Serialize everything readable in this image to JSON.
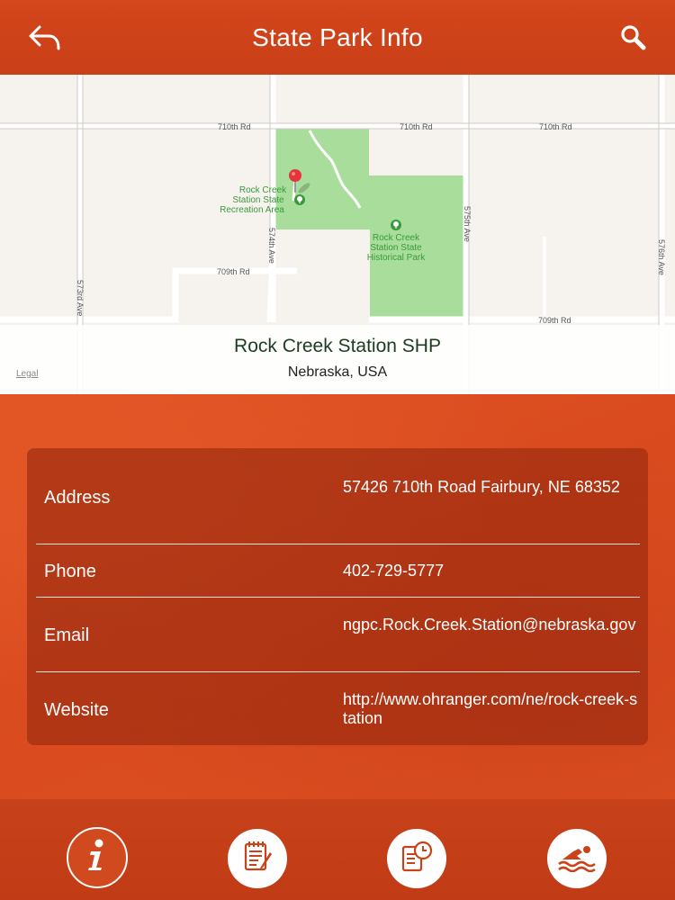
{
  "header": {
    "title": "State Park Info",
    "back_icon": "back-arrow-icon",
    "search_icon": "search-icon"
  },
  "map": {
    "road_labels": {
      "r710_left": "710th Rd",
      "r710_mid": "710th Rd",
      "r710_right": "710th Rd",
      "r709_left": "709th Rd",
      "r709_right": "709th Rd",
      "ave573": "573rd Ave",
      "ave574": "574th Ave",
      "ave575": "575th Ave",
      "ave576": "576th Ave"
    },
    "places": {
      "recreation_area": [
        "Rock Creek",
        "Station State",
        "Recreation Area"
      ],
      "historical_park": [
        "Rock Creek",
        "Station State",
        "Historical Park"
      ]
    },
    "legal": "Legal",
    "park_name": "Rock Creek Station SHP",
    "location": "Nebraska, USA",
    "colors": {
      "park_green": "#a8dd9c",
      "pin": "#e8333a",
      "label_green": "#3a9a3a"
    }
  },
  "details": {
    "address_label": "Address",
    "address_value": "57426 710th Road Fairbury, NE 68352",
    "phone_label": "Phone",
    "phone_value": "402-729-5777",
    "email_label": "Email",
    "email_value": "ngpc.Rock.Creek.Station@nebraska.gov",
    "website_label": "Website",
    "website_value": "http://www.ohranger.com/ne/rock-creek-station"
  },
  "tabs": [
    {
      "icon": "info-icon",
      "active": true
    },
    {
      "icon": "notes-icon",
      "active": false
    },
    {
      "icon": "schedule-icon",
      "active": false
    },
    {
      "icon": "swimming-icon",
      "active": false
    }
  ],
  "colors": {
    "accent": "#d4461c"
  }
}
